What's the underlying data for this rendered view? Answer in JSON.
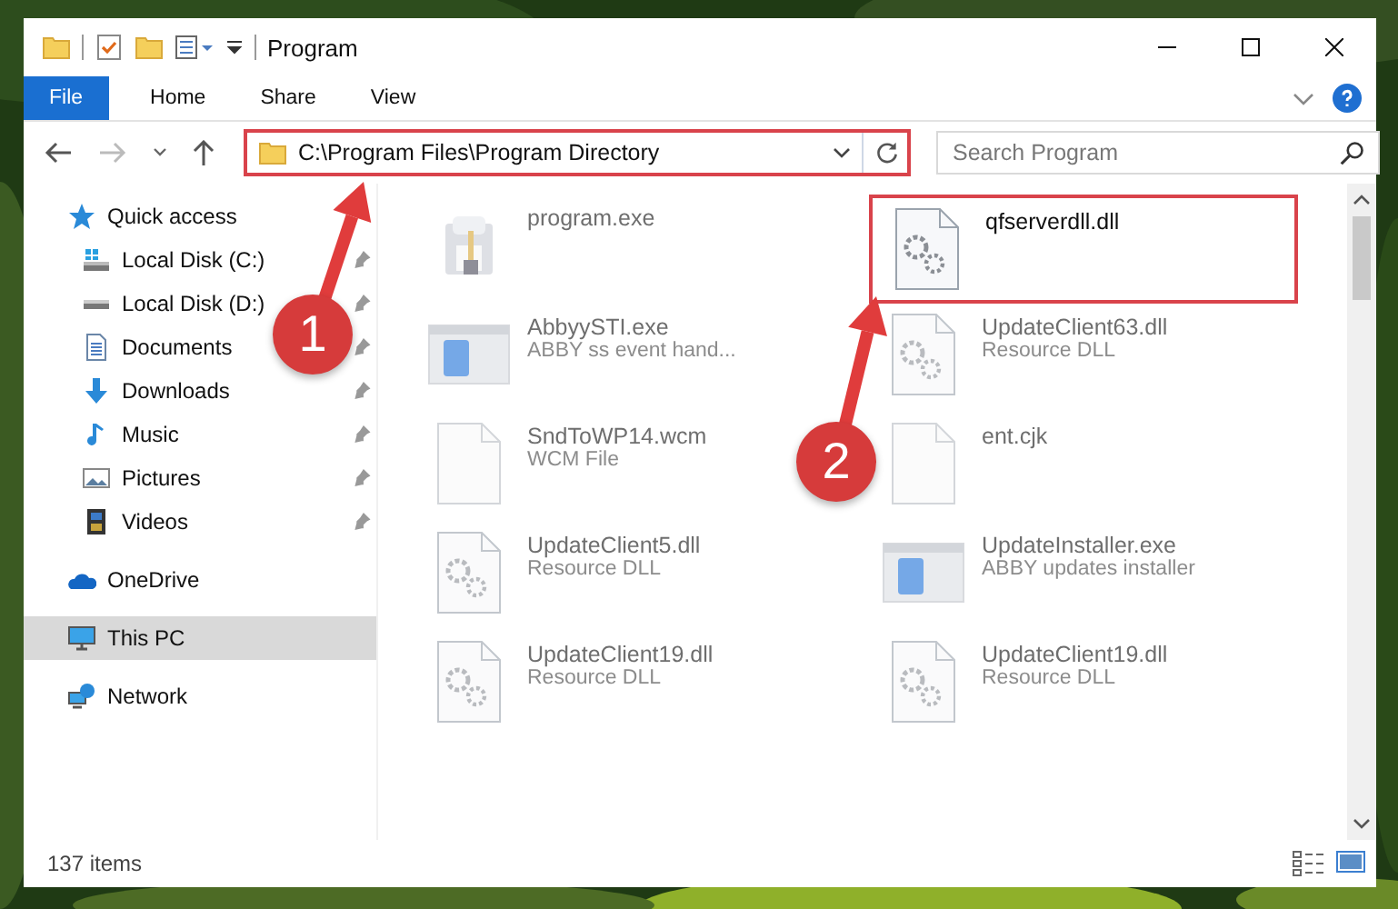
{
  "window": {
    "title": "Program"
  },
  "ribbon": {
    "tabs": [
      {
        "label": "File",
        "selected": true
      },
      {
        "label": "Home",
        "selected": false
      },
      {
        "label": "Share",
        "selected": false
      },
      {
        "label": "View",
        "selected": false
      }
    ]
  },
  "address": {
    "path": "C:\\Program Files\\Program Directory",
    "highlighted": true
  },
  "search": {
    "placeholder": "Search Program"
  },
  "sidebar": {
    "items": [
      {
        "label": "Quick access",
        "kind": "star",
        "selected": false,
        "children": [
          {
            "label": "Local Disk (C:)",
            "kind": "system-drive",
            "pinned": true
          },
          {
            "label": "Local Disk (D:)",
            "kind": "drive",
            "pinned": true
          },
          {
            "label": "Documents",
            "kind": "document",
            "pinned": true
          },
          {
            "label": "Downloads",
            "kind": "download",
            "pinned": true
          },
          {
            "label": "Music",
            "kind": "music",
            "pinned": true
          },
          {
            "label": "Pictures",
            "kind": "pictures",
            "pinned": true
          },
          {
            "label": "Videos",
            "kind": "video",
            "pinned": true
          }
        ]
      },
      {
        "label": "OneDrive",
        "kind": "cloud",
        "selected": false
      },
      {
        "label": "This PC",
        "kind": "computer",
        "selected": true
      },
      {
        "label": "Network",
        "kind": "network",
        "selected": false
      }
    ]
  },
  "files": [
    {
      "name": "program.exe",
      "kind": "installer",
      "blurred": true,
      "highlighted": false
    },
    {
      "name": "qfserverdll.dll",
      "kind": "dll",
      "blurred": false,
      "highlighted": true
    },
    {
      "name": "AbbyySTI.exe",
      "description": "ABBY ss event hand...",
      "kind": "app",
      "blurred": true,
      "highlighted": false
    },
    {
      "name": "UpdateClient63.dll",
      "description": "Resource DLL",
      "kind": "dll",
      "blurred": true,
      "highlighted": false
    },
    {
      "name": "SndToWP14.wcm",
      "description": "WCM File",
      "kind": "file",
      "blurred": true,
      "highlighted": false
    },
    {
      "name": "ent.cjk",
      "kind": "file",
      "blurred": true,
      "highlighted": false
    },
    {
      "name": "UpdateClient5.dll",
      "description": "Resource DLL",
      "kind": "dll",
      "blurred": true,
      "highlighted": false
    },
    {
      "name": "UpdateInstaller.exe",
      "description": "ABBY updates installer",
      "kind": "app",
      "blurred": true,
      "highlighted": false
    },
    {
      "name": "UpdateClient19.dll",
      "description": "Resource DLL",
      "kind": "dll",
      "blurred": true,
      "highlighted": false
    },
    {
      "name": "UpdateClient19.dll",
      "description": "Resource DLL",
      "kind": "dll",
      "blurred": true,
      "highlighted": false
    }
  ],
  "status_bar": {
    "count": "137 items"
  },
  "annotations": [
    {
      "number": "1"
    },
    {
      "number": "2"
    }
  ]
}
